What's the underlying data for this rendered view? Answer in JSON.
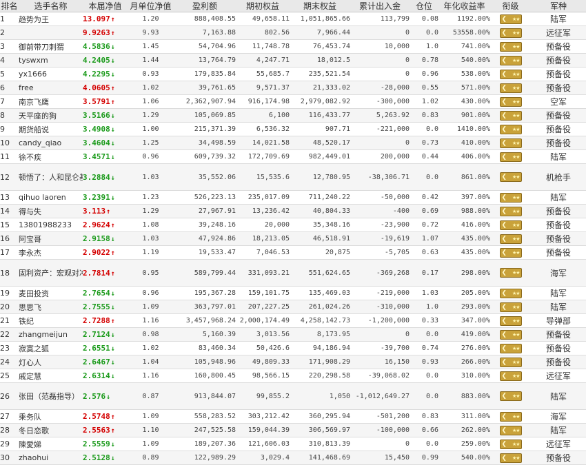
{
  "headers": [
    "排名",
    "选手名称",
    "本届净值",
    "月单位净值",
    "盈利额",
    "期初权益",
    "期末权益",
    "累计出入金",
    "仓位",
    "年化收益率",
    "衔级",
    "军种"
  ],
  "colors": {
    "up": "#d40000",
    "down": "#1a9a1a",
    "badge": "#c9a23a"
  },
  "rows": [
    {
      "rank": "1",
      "name": "趋势为王",
      "nav": "13.097",
      "trend": "up",
      "monthly": "1.20",
      "profit": "888,408.55",
      "begin": "49,658.11",
      "end": "1,051,865.66",
      "flow": "113,799",
      "position": "0.08",
      "annual": "1192.00%",
      "rank_icon": "rank-badge-icon",
      "branch": "陆军"
    },
    {
      "rank": "2",
      "name": "",
      "nav": "9.9263",
      "trend": "up",
      "monthly": "9.93",
      "profit": "7,163.88",
      "begin": "802.56",
      "end": "7,966.44",
      "flow": "0",
      "position": "0.0",
      "annual": "53558.00%",
      "rank_icon": "rank-badge-icon",
      "branch": "远征军"
    },
    {
      "rank": "3",
      "name": "御前带刀刺猬",
      "nav": "4.5836",
      "trend": "down",
      "monthly": "1.45",
      "profit": "54,704.96",
      "begin": "11,748.78",
      "end": "76,453.74",
      "flow": "10,000",
      "position": "1.0",
      "annual": "741.00%",
      "rank_icon": "rank-badge-icon",
      "branch": "预备役"
    },
    {
      "rank": "4",
      "name": "tyswxm",
      "nav": "4.2405",
      "trend": "down",
      "monthly": "1.44",
      "profit": "13,764.79",
      "begin": "4,247.71",
      "end": "18,012.5",
      "flow": "0",
      "position": "0.78",
      "annual": "540.00%",
      "rank_icon": "rank-badge-icon",
      "branch": "预备役"
    },
    {
      "rank": "5",
      "name": "yx1666",
      "nav": "4.2295",
      "trend": "down",
      "monthly": "0.93",
      "profit": "179,835.84",
      "begin": "55,685.7",
      "end": "235,521.54",
      "flow": "0",
      "position": "0.96",
      "annual": "538.00%",
      "rank_icon": "rank-badge-icon",
      "branch": "预备役"
    },
    {
      "rank": "6",
      "name": "free",
      "nav": "4.0605",
      "trend": "up",
      "monthly": "1.02",
      "profit": "39,761.65",
      "begin": "9,571.37",
      "end": "21,333.02",
      "flow": "-28,000",
      "position": "0.55",
      "annual": "571.00%",
      "rank_icon": "rank-badge-icon",
      "branch": "预备役"
    },
    {
      "rank": "7",
      "name": "南京飞鹰",
      "nav": "3.5791",
      "trend": "up",
      "monthly": "1.06",
      "profit": "2,362,907.94",
      "begin": "916,174.98",
      "end": "2,979,082.92",
      "flow": "-300,000",
      "position": "1.02",
      "annual": "430.00%",
      "rank_icon": "rank-badge-icon",
      "branch": "空军"
    },
    {
      "rank": "8",
      "name": "天平座的狗",
      "nav": "3.5166",
      "trend": "down",
      "monthly": "1.29",
      "profit": "105,069.85",
      "begin": "6,100",
      "end": "116,433.77",
      "flow": "5,263.92",
      "position": "0.83",
      "annual": "901.00%",
      "rank_icon": "rank-badge-icon",
      "branch": "预备役"
    },
    {
      "rank": "9",
      "name": "期货船说",
      "nav": "3.4908",
      "trend": "down",
      "monthly": "1.00",
      "profit": "215,371.39",
      "begin": "6,536.32",
      "end": "907.71",
      "flow": "-221,000",
      "position": "0.0",
      "annual": "1410.00%",
      "rank_icon": "rank-badge-icon",
      "branch": "预备役"
    },
    {
      "rank": "10",
      "name": "candy_qiao",
      "nav": "3.4604",
      "trend": "down",
      "monthly": "1.25",
      "profit": "34,498.59",
      "begin": "14,021.58",
      "end": "48,520.17",
      "flow": "0",
      "position": "0.73",
      "annual": "410.00%",
      "rank_icon": "rank-badge-icon",
      "branch": "预备役"
    },
    {
      "rank": "11",
      "name": "徐不疾",
      "nav": "3.4571",
      "trend": "down",
      "monthly": "0.96",
      "profit": "609,739.32",
      "begin": "172,709.69",
      "end": "982,449.01",
      "flow": "200,000",
      "position": "0.44",
      "annual": "406.00%",
      "rank_icon": "rank-badge-icon",
      "branch": "陆军"
    },
    {
      "rank": "12",
      "name": "顿悟了：人和昆仑基金",
      "nav": "3.2884",
      "trend": "down",
      "monthly": "1.03",
      "profit": "35,552.06",
      "begin": "15,535.6",
      "end": "12,780.95",
      "flow": "-38,306.71",
      "position": "0.0",
      "annual": "861.00%",
      "rank_icon": "rank-badge-icon",
      "branch": "机枪手"
    },
    {
      "rank": "13",
      "name": "qihuo laoren",
      "nav": "3.2391",
      "trend": "down",
      "monthly": "1.23",
      "profit": "526,223.13",
      "begin": "235,017.09",
      "end": "711,240.22",
      "flow": "-50,000",
      "position": "0.42",
      "annual": "397.00%",
      "rank_icon": "rank-badge-icon",
      "branch": "陆军"
    },
    {
      "rank": "14",
      "name": "得与失",
      "nav": "3.113",
      "trend": "up",
      "monthly": "1.29",
      "profit": "27,967.91",
      "begin": "13,236.42",
      "end": "40,804.33",
      "flow": "-400",
      "position": "0.69",
      "annual": "988.00%",
      "rank_icon": "rank-badge-icon",
      "branch": "预备役"
    },
    {
      "rank": "15",
      "name": "13801988233",
      "nav": "2.9624",
      "trend": "up",
      "monthly": "1.08",
      "profit": "39,248.16",
      "begin": "20,000",
      "end": "35,348.16",
      "flow": "-23,900",
      "position": "0.72",
      "annual": "416.00%",
      "rank_icon": "rank-badge-icon",
      "branch": "预备役"
    },
    {
      "rank": "16",
      "name": "阿宝哥",
      "nav": "2.9158",
      "trend": "down",
      "monthly": "1.03",
      "profit": "47,924.86",
      "begin": "18,213.05",
      "end": "46,518.91",
      "flow": "-19,619",
      "position": "1.07",
      "annual": "435.00%",
      "rank_icon": "rank-badge-icon",
      "branch": "预备役"
    },
    {
      "rank": "17",
      "name": "李永杰",
      "nav": "2.9022",
      "trend": "up",
      "monthly": "1.19",
      "profit": "19,533.47",
      "begin": "7,046.53",
      "end": "20,875",
      "flow": "-5,705",
      "position": "0.63",
      "annual": "435.00%",
      "rank_icon": "rank-badge-icon",
      "branch": "预备役"
    },
    {
      "rank": "18",
      "name": "固利资产：宏观对冲",
      "nav": "2.7814",
      "trend": "up",
      "monthly": "0.95",
      "profit": "589,799.44",
      "begin": "331,093.21",
      "end": "551,624.65",
      "flow": "-369,268",
      "position": "0.17",
      "annual": "298.00%",
      "rank_icon": "rank-badge-icon",
      "branch": "海军"
    },
    {
      "rank": "19",
      "name": "麦田投资",
      "nav": "2.7654",
      "trend": "down",
      "monthly": "0.96",
      "profit": "195,367.28",
      "begin": "159,101.75",
      "end": "135,469.03",
      "flow": "-219,000",
      "position": "1.03",
      "annual": "205.00%",
      "rank_icon": "rank-badge-icon",
      "branch": "陆军"
    },
    {
      "rank": "20",
      "name": "思思飞",
      "nav": "2.7555",
      "trend": "down",
      "monthly": "1.09",
      "profit": "363,797.01",
      "begin": "207,227.25",
      "end": "261,024.26",
      "flow": "-310,000",
      "position": "1.0",
      "annual": "293.00%",
      "rank_icon": "rank-badge-icon",
      "branch": "陆军"
    },
    {
      "rank": "21",
      "name": "铁纪",
      "nav": "2.7288",
      "trend": "up",
      "monthly": "1.16",
      "profit": "3,457,968.24",
      "begin": "2,000,174.49",
      "end": "4,258,142.73",
      "flow": "-1,200,000",
      "position": "0.33",
      "annual": "347.00%",
      "rank_icon": "rank-badge-icon",
      "branch": "导弹部"
    },
    {
      "rank": "22",
      "name": "zhangmeijun",
      "nav": "2.7124",
      "trend": "down",
      "monthly": "0.98",
      "profit": "5,160.39",
      "begin": "3,013.56",
      "end": "8,173.95",
      "flow": "0",
      "position": "0.0",
      "annual": "419.00%",
      "rank_icon": "rank-badge-icon",
      "branch": "预备役"
    },
    {
      "rank": "23",
      "name": "寂寞之狐",
      "nav": "2.6551",
      "trend": "down",
      "monthly": "1.02",
      "profit": "83,460.34",
      "begin": "50,426.6",
      "end": "94,186.94",
      "flow": "-39,700",
      "position": "0.74",
      "annual": "276.00%",
      "rank_icon": "rank-badge-icon",
      "branch": "预备役"
    },
    {
      "rank": "24",
      "name": "灯心人",
      "nav": "2.6467",
      "trend": "down",
      "monthly": "1.04",
      "profit": "105,948.96",
      "begin": "49,809.33",
      "end": "171,908.29",
      "flow": "16,150",
      "position": "0.93",
      "annual": "266.00%",
      "rank_icon": "rank-badge-icon",
      "branch": "预备役"
    },
    {
      "rank": "25",
      "name": "戚定慧",
      "nav": "2.6314",
      "trend": "down",
      "monthly": "1.16",
      "profit": "160,800.45",
      "begin": "98,566.15",
      "end": "220,298.58",
      "flow": "-39,068.02",
      "position": "0.0",
      "annual": "310.00%",
      "rank_icon": "rank-badge-icon",
      "branch": "远征军"
    },
    {
      "rank": "26",
      "name": "张田（范磊指导）",
      "nav": "2.576",
      "trend": "down",
      "monthly": "0.87",
      "profit": "913,844.07",
      "begin": "99,855.2",
      "end": "1,050",
      "flow": "-1,012,649.27",
      "position": "0.0",
      "annual": "883.00%",
      "rank_icon": "rank-badge-icon",
      "branch": "陆军"
    },
    {
      "rank": "27",
      "name": "乘务队",
      "nav": "2.5748",
      "trend": "up",
      "monthly": "1.09",
      "profit": "558,283.52",
      "begin": "303,212.42",
      "end": "360,295.94",
      "flow": "-501,200",
      "position": "0.83",
      "annual": "311.00%",
      "rank_icon": "rank-badge-icon",
      "branch": "海军"
    },
    {
      "rank": "28",
      "name": "冬日恋歌",
      "nav": "2.5563",
      "trend": "up",
      "monthly": "1.10",
      "profit": "247,525.58",
      "begin": "159,044.39",
      "end": "306,569.97",
      "flow": "-100,000",
      "position": "0.66",
      "annual": "262.00%",
      "rank_icon": "rank-badge-icon",
      "branch": "陆军"
    },
    {
      "rank": "29",
      "name": "陳愛娣",
      "nav": "2.5559",
      "trend": "down",
      "monthly": "1.09",
      "profit": "189,207.36",
      "begin": "121,606.03",
      "end": "310,813.39",
      "flow": "0",
      "position": "0.0",
      "annual": "259.00%",
      "rank_icon": "rank-badge-icon",
      "branch": "远征军"
    },
    {
      "rank": "30",
      "name": "zhaohui",
      "nav": "2.5128",
      "trend": "down",
      "monthly": "0.89",
      "profit": "122,989.29",
      "begin": "3,029.4",
      "end": "141,468.69",
      "flow": "15,450",
      "position": "0.99",
      "annual": "540.00%",
      "rank_icon": "rank-badge-icon",
      "branch": "预备役"
    }
  ]
}
